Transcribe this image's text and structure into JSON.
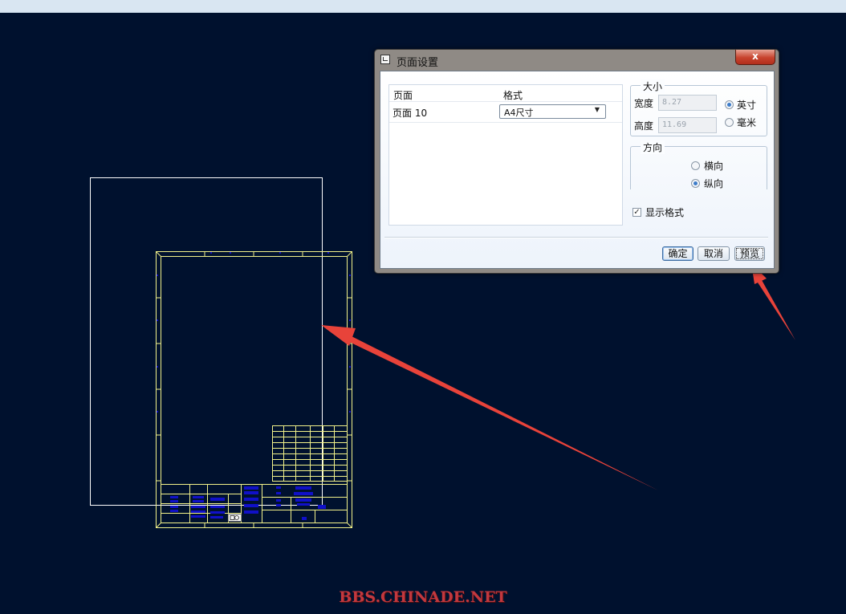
{
  "dialog": {
    "title": "页面设置",
    "close_glyph": "x",
    "table": {
      "col_page": "页面",
      "col_format": "格式",
      "rows": [
        {
          "page": "页面 10",
          "format": "A4尺寸"
        }
      ]
    },
    "size": {
      "group_label": "大小",
      "width_label": "宽度",
      "width_value": "8.27",
      "height_label": "高度",
      "height_value": "11.69",
      "unit_inch": "英寸",
      "unit_mm": "毫米",
      "selected_unit": "英寸"
    },
    "orientation": {
      "group_label": "方向",
      "landscape": "横向",
      "portrait": "纵向",
      "selected": "纵向"
    },
    "show_format": {
      "label": "显示格式",
      "checked": true
    },
    "buttons": {
      "ok": "确定",
      "cancel": "取消",
      "preview": "预览"
    }
  },
  "watermark": "BBS.CHINADE.NET",
  "colors": {
    "canvas_bg": "#00112e",
    "outline": "#ffffff",
    "frame": "#f2f28a",
    "symbols": "#1010c8",
    "arrow": "#e8433a",
    "watermark": "#c2383e"
  }
}
